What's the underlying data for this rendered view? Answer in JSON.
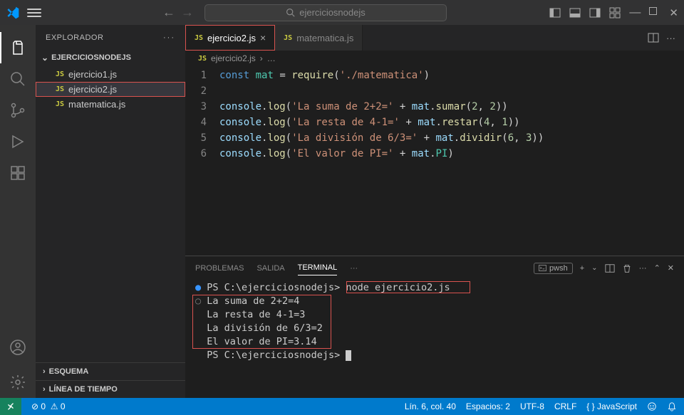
{
  "titlebar": {
    "search_placeholder": "ejerciciosnodejs"
  },
  "sidebar": {
    "title": "EXPLORADOR",
    "folder": "EJERCICIOSNODEJS",
    "files": [
      {
        "name": "ejercicio1.js",
        "icon": "JS"
      },
      {
        "name": "ejercicio2.js",
        "icon": "JS",
        "selected": true
      },
      {
        "name": "matematica.js",
        "icon": "JS"
      }
    ],
    "outline": "ESQUEMA",
    "timeline": "LÍNEA DE TIEMPO"
  },
  "tabs": [
    {
      "label": "ejercicio2.js",
      "active": true
    },
    {
      "label": "matematica.js",
      "active": false
    }
  ],
  "breadcrumb": {
    "file": "ejercicio2.js",
    "sep": "›",
    "more": "…"
  },
  "code": {
    "lines": [
      "const mat = require('./matematica')",
      "",
      "console.log('La suma de 2+2=' + mat.sumar(2, 2))",
      "console.log('La resta de 4-1=' + mat.restar(4, 1))",
      "console.log('La división de 6/3=' + mat.dividir(6, 3))",
      "console.log('El valor de PI=' + mat.PI)"
    ],
    "tokens": {
      "const": "const",
      "mat": "mat",
      "eq": " = ",
      "require": "require",
      "lparen": "(",
      "rparen": ")",
      "path": "'./matematica'",
      "console": "console",
      "dot": ".",
      "log": "log",
      "s_suma": "'La suma de 2+2='",
      "s_resta": "'La resta de 4-1='",
      "s_div": "'La división de 6/3='",
      "s_pi": "'El valor de PI='",
      "plus": " + ",
      "comma": ", ",
      "sumar": "sumar",
      "restar": "restar",
      "dividir": "dividir",
      "PI": "PI",
      "n2": "2",
      "n4": "4",
      "n1": "1",
      "n6": "6",
      "n3": "3"
    }
  },
  "panel": {
    "tabs": {
      "problems": "PROBLEMAS",
      "output": "SALIDA",
      "terminal": "TERMINAL",
      "more": "···"
    },
    "shell": "pwsh",
    "terminal": {
      "prompt": "PS C:\\ejerciciosnodejs>",
      "cmd": "node ejercicio2.js",
      "out": [
        "La suma de 2+2=4",
        "La resta de 4-1=3",
        "La división de 6/3=2",
        "El valor de PI=3.14"
      ]
    }
  },
  "status": {
    "errors": "0",
    "warnings": "0",
    "lncol": "Lín. 6, col. 40",
    "spaces": "Espacios: 2",
    "encoding": "UTF-8",
    "eol": "CRLF",
    "lang": "JavaScript"
  }
}
